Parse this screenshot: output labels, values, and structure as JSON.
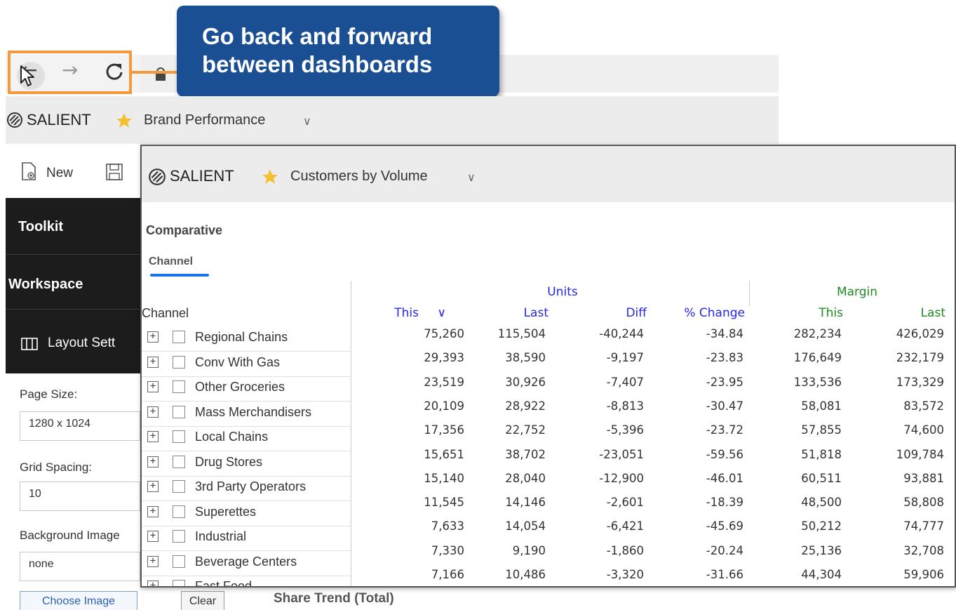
{
  "callout": {
    "line1": "Go back and forward",
    "line2": "between dashboards"
  },
  "browser": {
    "back": "←",
    "forward": "→",
    "reload": "C"
  },
  "back_dashboard": {
    "brand": "SALIENT",
    "name": "Brand Performance",
    "toolbar": {
      "new_label": "New"
    },
    "toolkit_label": "Toolkit",
    "workspace_label": "Workspace",
    "layout_settings_label": "Layout Sett",
    "page_size_label": "Page Size:",
    "page_size_value": "1280 x 1024",
    "grid_spacing_label": "Grid Spacing:",
    "grid_spacing_value": "10",
    "background_image_label": "Background Image",
    "background_image_value": "none",
    "choose_image_label": "Choose Image",
    "clear_label": "Clear",
    "share_trend_label": "Share Trend (Total)"
  },
  "front_dashboard": {
    "brand": "SALIENT",
    "name": "Customers by Volume",
    "section_title": "Comparative",
    "tab_label": "Channel",
    "dimension_header": "Channel",
    "groups": {
      "units": "Units",
      "margin": "Margin"
    },
    "columns": {
      "units_this": "This",
      "units_last": "Last",
      "units_diff": "Diff",
      "units_pct": "% Change",
      "margin_this": "This",
      "margin_last": "Last"
    },
    "sort_indicator": "∨",
    "rows": [
      {
        "label": "Regional Chains",
        "vals": [
          "75,260",
          "115,504",
          "-40,244",
          "-34.84",
          "282,234",
          "426,029"
        ]
      },
      {
        "label": "Conv With Gas",
        "vals": [
          "29,393",
          "38,590",
          "-9,197",
          "-23.83",
          "176,649",
          "232,179"
        ]
      },
      {
        "label": "Other Groceries",
        "vals": [
          "23,519",
          "30,926",
          "-7,407",
          "-23.95",
          "133,536",
          "173,329"
        ]
      },
      {
        "label": "Mass Merchandisers",
        "vals": [
          "20,109",
          "28,922",
          "-8,813",
          "-30.47",
          "58,081",
          "83,572"
        ]
      },
      {
        "label": "Local Chains",
        "vals": [
          "17,356",
          "22,752",
          "-5,396",
          "-23.72",
          "57,855",
          "74,600"
        ]
      },
      {
        "label": "Drug Stores",
        "vals": [
          "15,651",
          "38,702",
          "-23,051",
          "-59.56",
          "51,818",
          "109,784"
        ]
      },
      {
        "label": "3rd Party Operators",
        "vals": [
          "15,140",
          "28,040",
          "-12,900",
          "-46.01",
          "60,511",
          "93,881"
        ]
      },
      {
        "label": "Superettes",
        "vals": [
          "11,545",
          "14,146",
          "-2,601",
          "-18.39",
          "48,500",
          "58,808"
        ]
      },
      {
        "label": "Industrial",
        "vals": [
          "7,633",
          "14,054",
          "-6,421",
          "-45.69",
          "50,212",
          "74,777"
        ]
      },
      {
        "label": "Beverage Centers",
        "vals": [
          "7,330",
          "9,190",
          "-1,860",
          "-20.24",
          "25,136",
          "32,708"
        ]
      },
      {
        "label": "Fast Food",
        "vals": [
          "7,166",
          "10,486",
          "-3,320",
          "-31.66",
          "44,304",
          "59,906"
        ]
      }
    ]
  },
  "colors": {
    "callout": "#1b4f94",
    "highlight": "#f59a3c",
    "units_header": "#2525e8",
    "margin_header": "#1e8a1e",
    "tab_underline": "#1a73e8"
  }
}
